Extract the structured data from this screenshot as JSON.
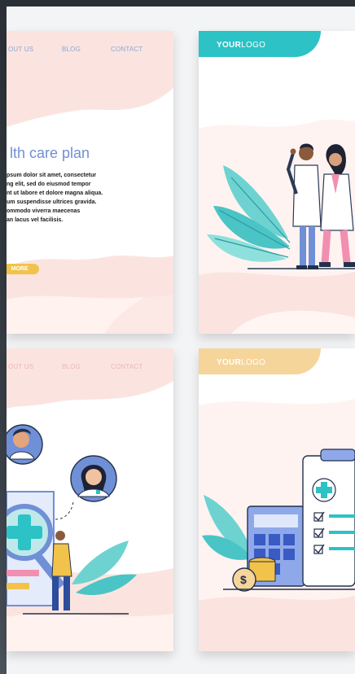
{
  "cards": {
    "top_left": {
      "nav": [
        "OUT US",
        "BLOG",
        "CONTACT"
      ],
      "title": "lth care plan",
      "body_lines": [
        "psum dolor sit amet, consectetur",
        "ng elit, sed do eiusmod tempor",
        "nt ut labore et dolore magna aliqua.",
        "um suspendisse ultrices gravida.",
        "ommodo viverra maecenas",
        "an lacus vel facilisis."
      ],
      "button": "MORE"
    },
    "top_right": {
      "logo_bold": "YOUR",
      "logo_light": "LOGO"
    },
    "bottom_left": {
      "nav": [
        "OUT US",
        "BLOG",
        "CONTACT"
      ]
    },
    "bottom_right": {
      "logo_bold": "YOUR",
      "logo_light": "LOGO"
    }
  },
  "colors": {
    "accent_blue": "#6f8fd6",
    "teal": "#2cc2c6",
    "sand": "#f6d59a",
    "pink_bg": "#fbe4df",
    "yellow_button": "#f2c34a",
    "dark_navy": "#23304a"
  },
  "icons": [
    "medical-cross-icon",
    "checkbox-icon",
    "dollar-coin-icon",
    "calculator-icon"
  ]
}
